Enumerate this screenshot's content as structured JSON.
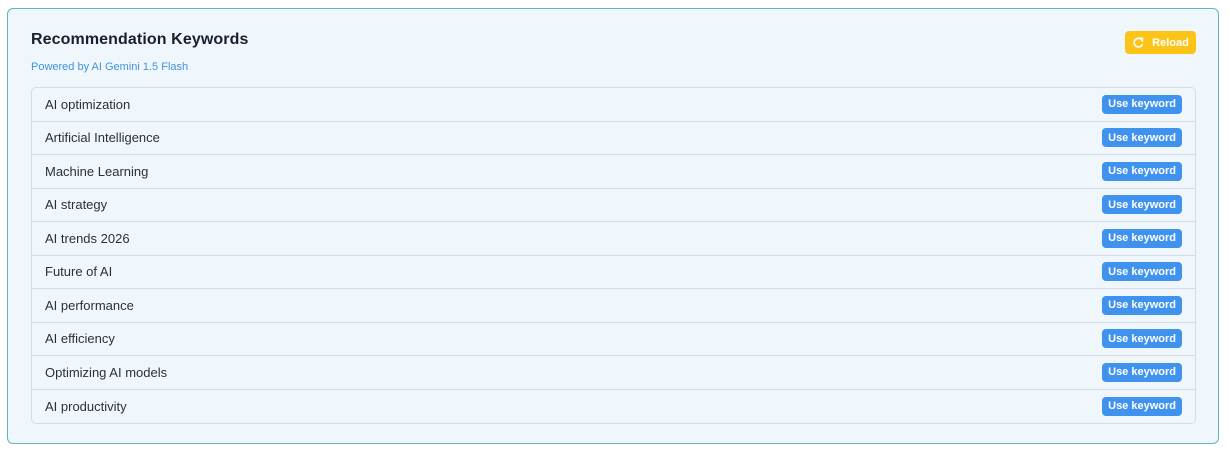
{
  "header": {
    "title": "Recommendation Keywords",
    "subtitle": "Powered by AI Gemini 1.5 Flash",
    "reload_label": "Reload"
  },
  "keywords": [
    {
      "text": "AI optimization",
      "action": "Use keyword"
    },
    {
      "text": "Artificial Intelligence",
      "action": "Use keyword"
    },
    {
      "text": "Machine Learning",
      "action": "Use keyword"
    },
    {
      "text": "AI strategy",
      "action": "Use keyword"
    },
    {
      "text": "AI trends 2026",
      "action": "Use keyword"
    },
    {
      "text": "Future of AI",
      "action": "Use keyword"
    },
    {
      "text": "AI performance",
      "action": "Use keyword"
    },
    {
      "text": "AI efficiency",
      "action": "Use keyword"
    },
    {
      "text": "Optimizing AI models",
      "action": "Use keyword"
    },
    {
      "text": "AI productivity",
      "action": "Use keyword"
    }
  ],
  "colors": {
    "card_bg": "#eff7fd",
    "card_border": "#5fb7b9",
    "reload_bg": "#fcc419",
    "use_button_bg": "#3f92ee",
    "subtitle": "#3f94df"
  },
  "icons": {
    "reload": "refresh-icon"
  }
}
